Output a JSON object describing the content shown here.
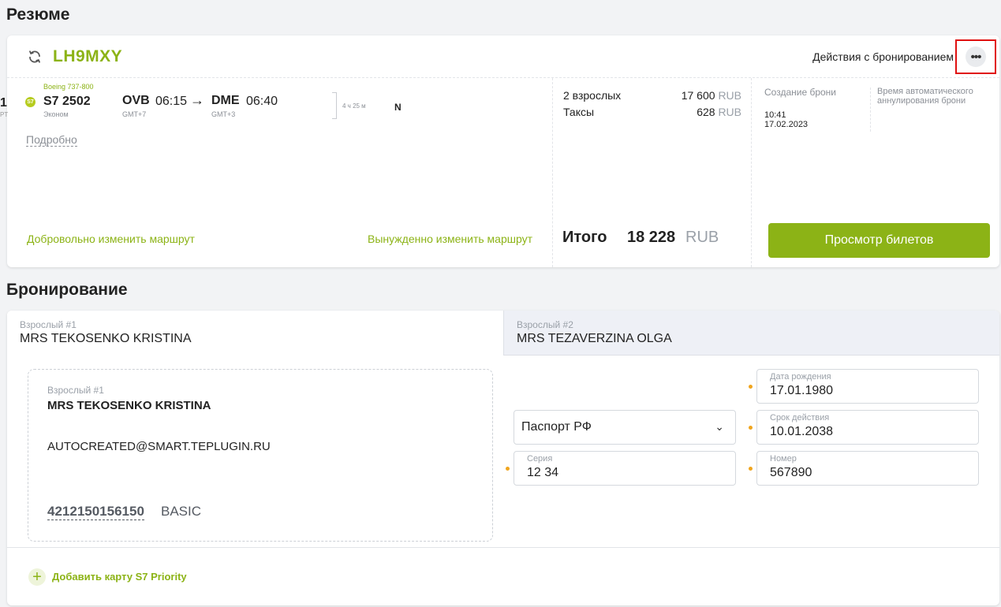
{
  "summary": {
    "section_title": "Резюме",
    "pnr": "LH9MXY",
    "actions_label": "Действия с бронированием",
    "actions_button": "•••",
    "partial_left_number": "1",
    "partial_left_sub": "PT",
    "flight": {
      "airline_logo": "S7",
      "aircraft": "Boeing 737-800",
      "flight_number": "S7  2502",
      "cabin": "Эконом",
      "departure_code": "OVB",
      "departure_time": "06:15",
      "departure_tz": "GMT+7",
      "arrival_code": "DME",
      "arrival_time": "06:40",
      "arrival_tz": "GMT+3",
      "duration": "4 ч 25 м",
      "fare_class": "N"
    },
    "details_link": "Подробно",
    "voluntary_change": "Добровольно изменить маршрут",
    "forced_change": "Вынужденно изменить маршрут",
    "price": {
      "rows": [
        {
          "label": "2 взрослых",
          "amount": "17 600",
          "currency": "RUB"
        },
        {
          "label": "Таксы",
          "amount": "628",
          "currency": "RUB"
        }
      ],
      "total_label": "Итого",
      "total_value": "18 228",
      "total_currency": "RUB"
    },
    "created_label": "Создание брони",
    "created_time": "10:41",
    "created_date": "17.02.2023",
    "autocancel_label": "Время автоматического аннулирования брони",
    "view_tickets_button": "Просмотр билетов"
  },
  "booking": {
    "section_title": "Бронирование",
    "tabs": [
      {
        "label": "Взрослый #1",
        "name": "MRS TEKOSENKO KRISTINA"
      },
      {
        "label": "Взрослый #2",
        "name": "MRS TEZAVERZINA OLGA"
      }
    ],
    "passenger": {
      "label": "Взрослый #1",
      "name": "MRS TEKOSENKO KRISTINA",
      "email": "AUTOCREATED@SMART.TEPLUGIN.RU",
      "loyalty_number": "4212150156150",
      "loyalty_tier": "BASIC"
    },
    "document": {
      "type": "Паспорт РФ",
      "birth_date_label": "Дата рождения",
      "birth_date": "17.01.1980",
      "expiry_label": "Срок действия",
      "expiry": "10.01.2038",
      "series_label": "Серия",
      "series": "12 34",
      "number_label": "Номер",
      "number": "567890"
    },
    "add_card_label": "Добавить карту S7 Priority"
  },
  "colors": {
    "accent": "#8cb316",
    "required_dot": "#f0a51e",
    "highlight_box": "#e01010"
  }
}
